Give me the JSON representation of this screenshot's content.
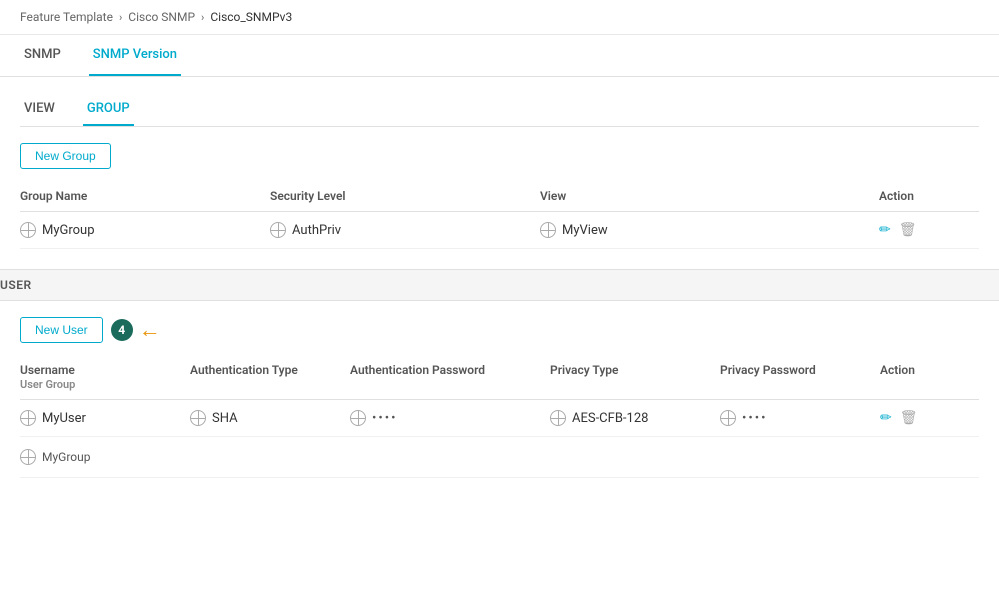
{
  "breadcrumb": {
    "items": [
      "Feature Template",
      "Cisco SNMP",
      "Cisco_SNMPv3"
    ]
  },
  "topTabs": [
    {
      "label": "SNMP",
      "active": false
    },
    {
      "label": "SNMP Version",
      "active": true
    }
  ],
  "subTabs": [
    {
      "label": "VIEW",
      "active": false
    },
    {
      "label": "GROUP",
      "active": true
    }
  ],
  "newGroupBtn": "New Group",
  "groupTable": {
    "headers": [
      "Group Name",
      "Security Level",
      "View",
      "Action"
    ],
    "rows": [
      {
        "groupName": "MyGroup",
        "securityLevel": "AuthPriv",
        "view": "MyView"
      }
    ]
  },
  "userSection": {
    "label": "USER",
    "newUserBtn": "New User",
    "badge": "4",
    "table": {
      "col1Header": "Username",
      "col1Sub": "User Group",
      "col2Header": "Authentication Type",
      "col3Header": "Authentication Password",
      "col4Header": "Privacy Type",
      "col5Header": "Privacy Password",
      "col6Header": "Action",
      "rows": [
        {
          "username": "MyUser",
          "userGroup": "MyGroup",
          "authType": "SHA",
          "authPassword": "••••",
          "privacyType": "AES-CFB-128",
          "privacyPassword": "••••"
        }
      ]
    }
  },
  "icons": {
    "edit": "✏",
    "delete": "🗑",
    "arrow": "←"
  }
}
